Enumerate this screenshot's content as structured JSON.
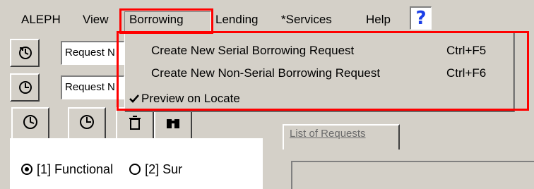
{
  "menubar": {
    "items": [
      "ALEPH",
      "View",
      "Borrowing",
      "Lending",
      "*Services",
      "Help"
    ],
    "help_badge": "?"
  },
  "toolbar": {
    "rows": [
      {
        "icon": "clock-arrow-icon",
        "combo_text": "Request N"
      },
      {
        "icon": "clock-circle-icon",
        "combo_text": "Request N"
      }
    ]
  },
  "left_tabs": [
    "clock-arrow-icon",
    "clock-circle-icon",
    "trash-icon",
    "binoculars-icon"
  ],
  "radio_options": [
    {
      "label": "[1] Functional",
      "selected": true
    },
    {
      "label": "[2] Sur",
      "selected": false
    }
  ],
  "right_panel": {
    "tab_label": "List of Requests"
  },
  "borrowing_menu": {
    "items": [
      {
        "label": "Create New Serial Borrowing Request",
        "shortcut": "Ctrl+F5",
        "checked": false
      },
      {
        "label": "Create New Non-Serial Borrowing Request",
        "shortcut": "Ctrl+F6",
        "checked": false
      },
      {
        "label": "Preview on Locate",
        "shortcut": "",
        "checked": true
      }
    ]
  },
  "highlight_color": "#ff0000"
}
